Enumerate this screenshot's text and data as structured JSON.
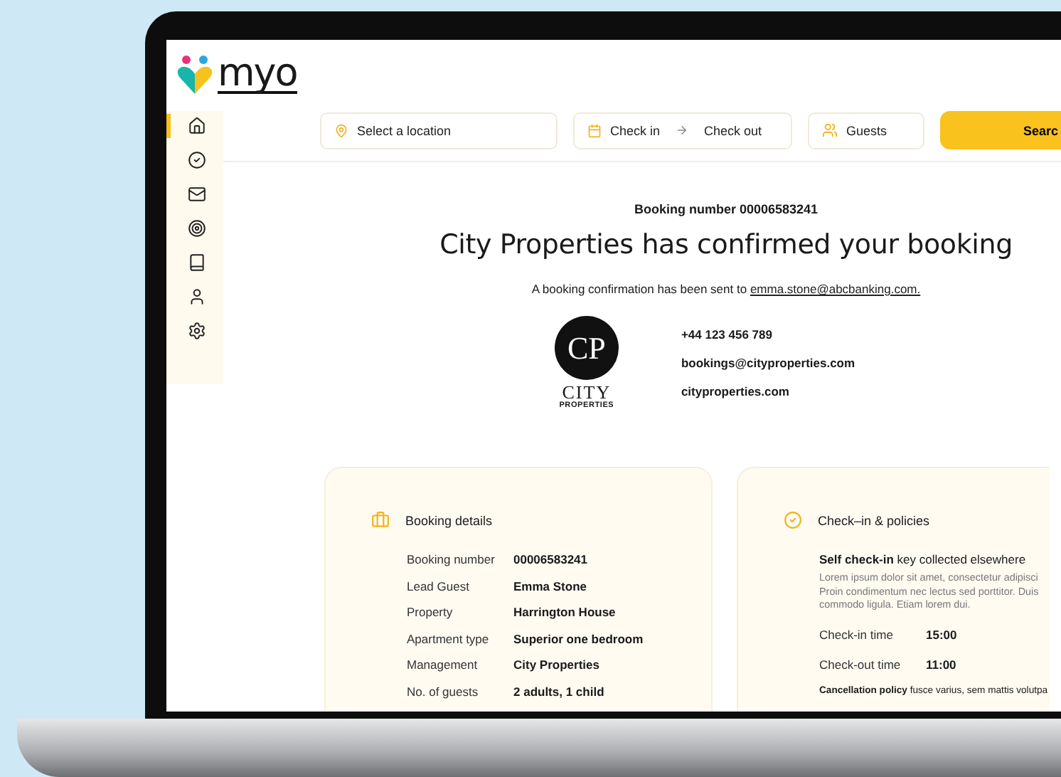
{
  "logo": {
    "text": "myo"
  },
  "sidebar": {
    "items": [
      {
        "kind": "home",
        "selected": true
      },
      {
        "kind": "check",
        "selected": false
      },
      {
        "kind": "mail",
        "selected": false
      },
      {
        "kind": "target",
        "selected": false
      },
      {
        "kind": "book",
        "selected": false
      },
      {
        "kind": "user",
        "selected": false
      },
      {
        "kind": "settings",
        "selected": false
      }
    ]
  },
  "search_bar": {
    "location": {
      "placeholder": "Select a location"
    },
    "check_in": {
      "placeholder": "Check in"
    },
    "check_out": {
      "placeholder": "Check out"
    },
    "guests": {
      "placeholder": "Guests"
    },
    "button": "Searc"
  },
  "booking_number_line": "Booking number 00006583241",
  "heading": "City Properties has confirmed your booking",
  "confirmation": {
    "text": "A booking confirmation has been sent to",
    "email": "emma.stone@abcbanking.com."
  },
  "company": {
    "logo_initials": "CP",
    "logo_name": "CITY",
    "logo_sub": "PROPERTIES",
    "phone": "+44 123 456 789",
    "email": "bookings@cityproperties.com",
    "website": "cityproperties.com"
  },
  "booking_details": {
    "title": "Booking details",
    "rows": [
      {
        "label": "Booking number",
        "value": "00006583241"
      },
      {
        "label": "Lead Guest",
        "value": "Emma Stone"
      },
      {
        "label": "Property",
        "value": "Harrington House"
      },
      {
        "label": "Apartment type",
        "value": "Superior one bedroom"
      },
      {
        "label": "Management",
        "value": "City Properties"
      },
      {
        "label": "No. of guests",
        "value": "2 adults, 1 child"
      }
    ]
  },
  "check_in_policies": {
    "title": "Check–in & policies",
    "self_check_in": "**Self check-in** key collected elsewhere",
    "description_lines": [
      "Lorem ipsum dolor sit amet, consectetur adipisci",
      "Proin condimentum nec lectus sed porttitor. Duis",
      "commodo ligula. Etiam lorem dui."
    ],
    "times": [
      {
        "label": "Check-in time",
        "value": "15:00"
      },
      {
        "label": "Check-out time",
        "value": "11:00"
      }
    ],
    "cancellation": "**Cancellation policy** fusce varius, sem mattis volutpa"
  }
}
